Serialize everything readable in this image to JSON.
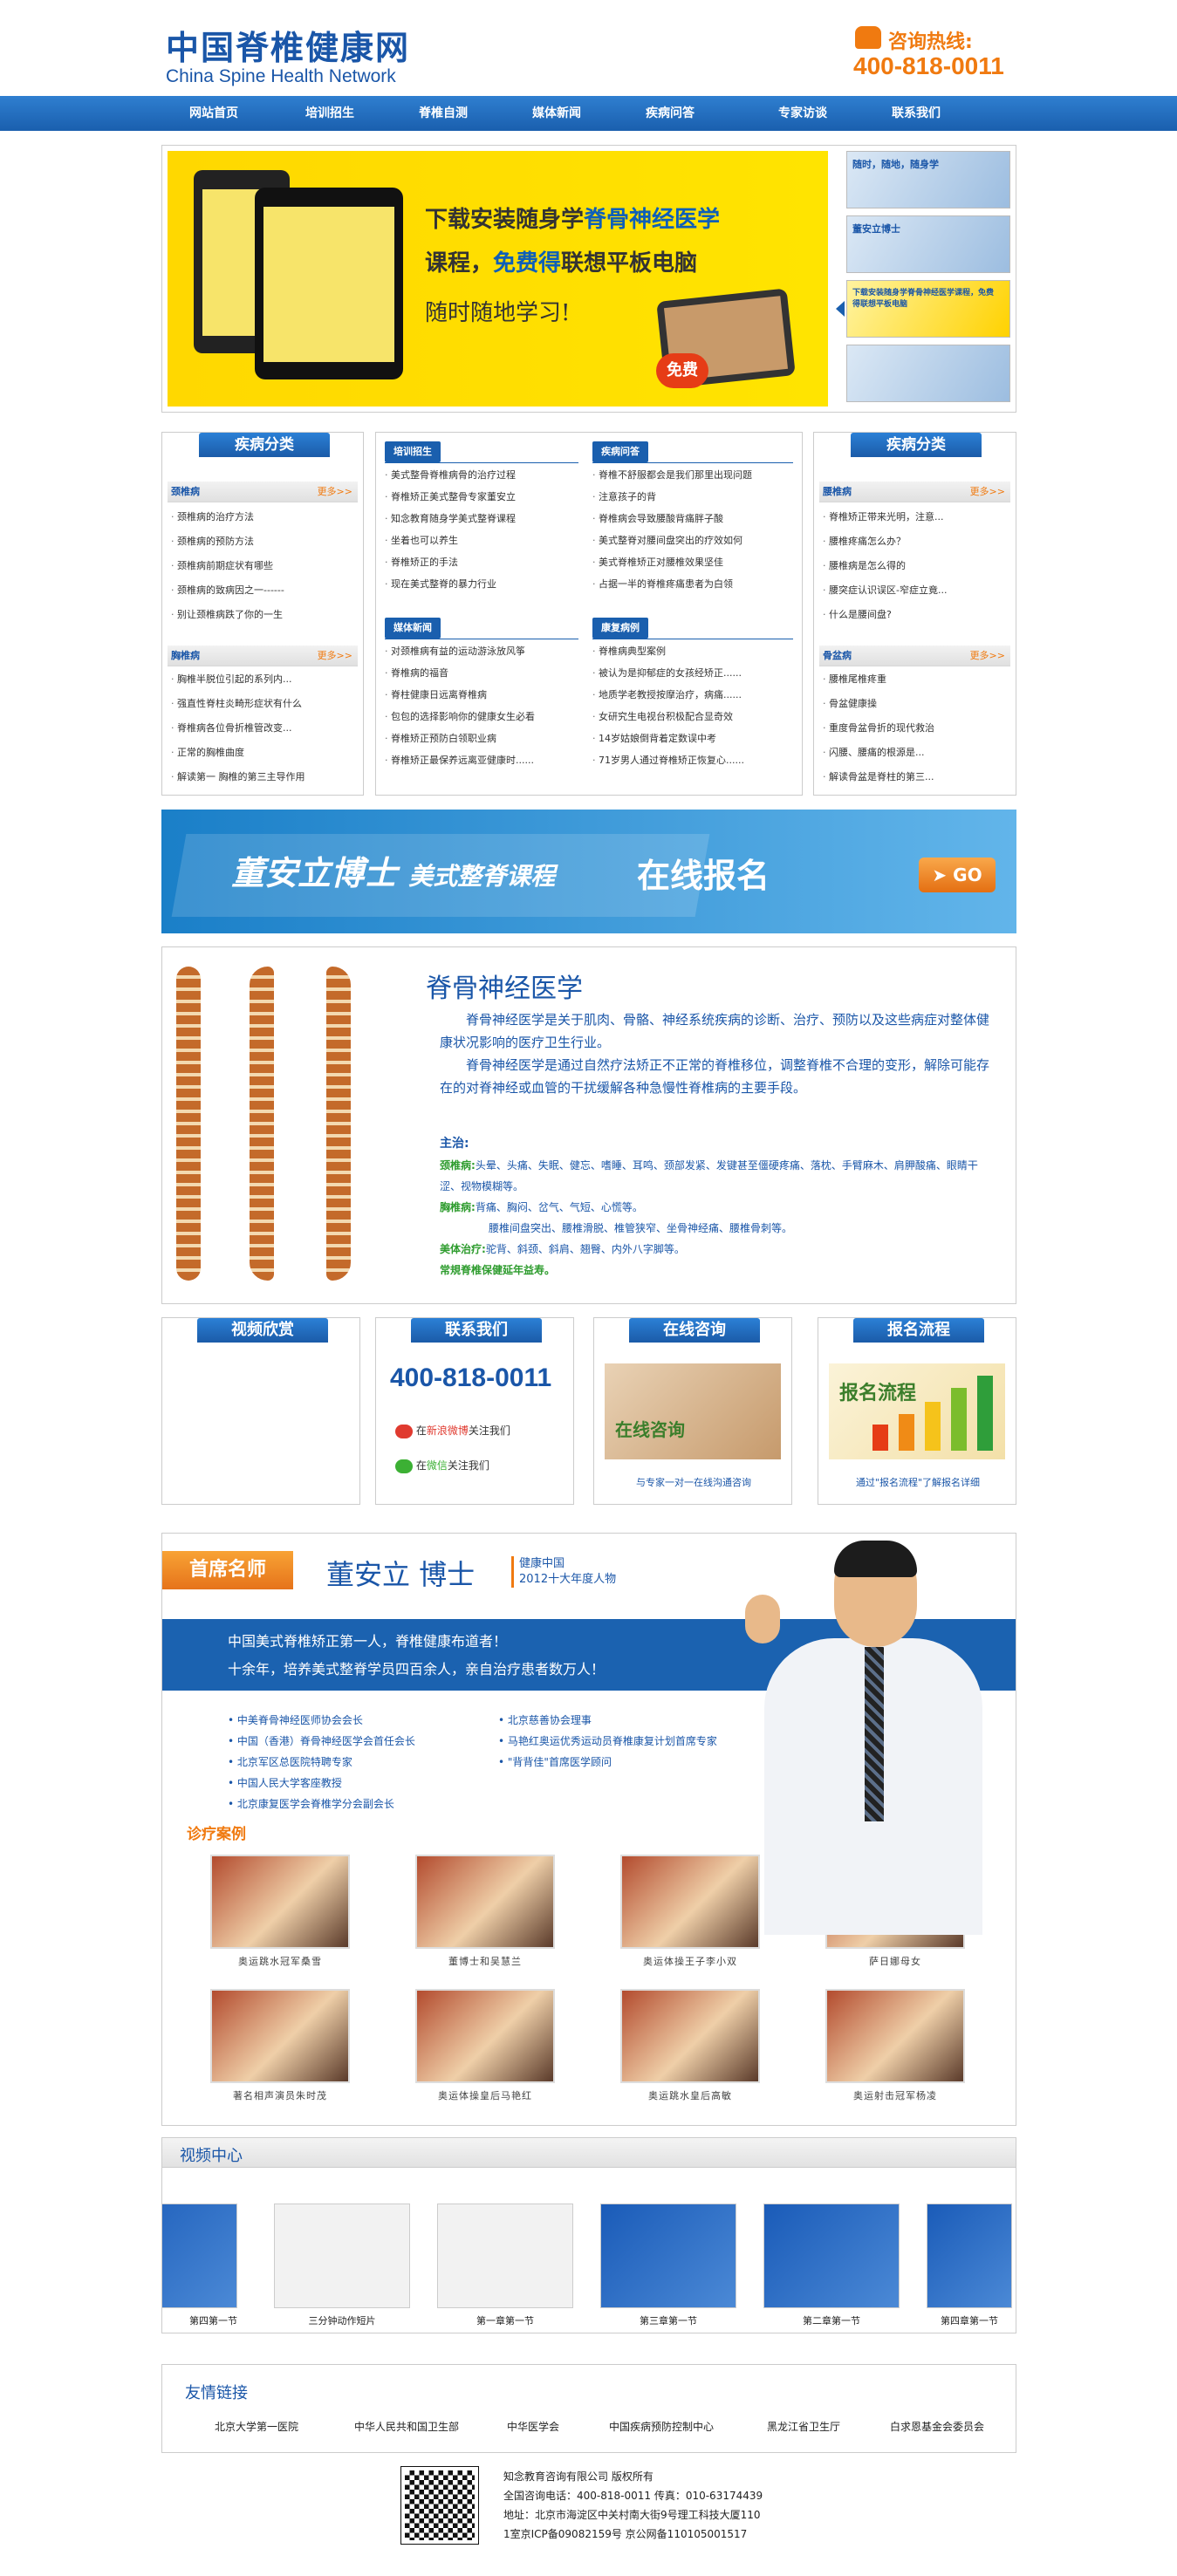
{
  "header": {
    "logo_title": "中国脊椎健康网",
    "logo_sub": "China Spine Health Network",
    "hotline_label": "咨询热线:",
    "hotline_number": "400-818-0011"
  },
  "nav": [
    "网站首页",
    "培训招生",
    "脊椎自测",
    "媒体新闻",
    "疾病问答",
    "专家访谈",
    "联系我们"
  ],
  "banner": {
    "line1_a": "下载安装随身学",
    "line1_b": "脊骨神经医学",
    "line2_a": "课程，",
    "line2_b": "免费得",
    "line2_c": "联想平板电脑",
    "line3": "随时随地学习!",
    "free": "免费",
    "thumbs": [
      "随时，随地，随身学",
      "董安立博士",
      "下载安装随身学脊骨神经医学课程，免费得联想平板电脑",
      ""
    ]
  },
  "left_cat": {
    "title": "疾病分类",
    "more": "更多>>",
    "g1_label": "颈椎病",
    "g1": [
      "颈椎病的治疗方法",
      "颈椎病的预防方法",
      "颈椎病前期症状有哪些",
      "颈椎病的致病因之一------",
      "别让颈椎病跌了你的一生"
    ],
    "g2_label": "胸椎病",
    "g2": [
      "胸椎半脱位引起的系列内...",
      "强直性脊柱炎畸形症状有什么",
      "脊椎病各位骨折椎管改变...",
      "正常的胸椎曲度",
      "解读第一 胸椎的第三主导作用"
    ]
  },
  "mid": {
    "h1": "培训招生",
    "l1": [
      "美式整骨脊椎病骨的治疗过程",
      "脊椎矫正美式整骨专家董安立",
      "知念教育随身学美式整脊课程",
      "坐着也可以养生",
      "脊椎矫正的手法",
      "现在美式整脊的暴力行业"
    ],
    "h2": "疾病问答",
    "l2": [
      "脊椎不舒服都会是我们那里出现问题",
      "注意孩子的背",
      "脊椎病会导致腰酸背痛胖子酸",
      "美式整脊对腰间盘突出的疗效如何",
      "美式脊椎矫正对腰椎效果坚佳",
      "占据一半的脊椎疼痛患者为白领"
    ],
    "h3": "媒体新闻",
    "l3": [
      "对颈椎病有益的运动游泳放风筝",
      "脊椎病的福音",
      "脊柱健康日远离脊椎病",
      "包包的选择影响你的健康女生必看",
      "脊椎矫正预防白领职业病",
      "脊椎矫正最保养远离亚健康时......"
    ],
    "h4": "康复病例",
    "l4": [
      "脊椎病典型案例",
      "被认为是抑郁症的女孩经矫正......",
      "地质学老教授按摩治疗，病痛......",
      "女研究生电视台积极配合显奇效",
      "14岁姑娘倒背着定数误中考",
      "71岁男人通过脊椎矫正恢复心......"
    ]
  },
  "right_cat": {
    "title": "疾病分类",
    "more": "更多>>",
    "g1_label": "腰椎病",
    "g1": [
      "脊椎矫正带来光明，注意...",
      "腰椎疼痛怎么办？",
      "腰椎病是怎么得的",
      "腰突症认识误区-窄症立竟...",
      "什么是腰间盘?"
    ],
    "g2_label": "骨盆病",
    "g2": [
      "腰椎尾椎疼重",
      "骨盆健康操",
      "重度骨盆骨折的现代救治",
      "闪腰、腰痛的根源是...",
      "解读骨盆是脊柱的第三..."
    ]
  },
  "dong_banner": {
    "title_a": "董安立博士",
    "title_b": "美式整脊课程",
    "online": "在线报名",
    "go": "GO"
  },
  "spine": {
    "title": "脊骨神经医学",
    "p1": "脊骨神经医学是关于肌肉、骨骼、神经系统疾病的诊断、治疗、预防以及这些病症对整体健康状况影响的医疗卫生行业。",
    "p2": "脊骨神经医学是通过自然疗法矫正不正常的脊椎移位，调整脊椎不合理的变形，解除可能存在的对脊神经或血管的干扰缓解各种急慢性脊椎病的主要手段。",
    "zhu": "主治:",
    "r1_k": "颈椎病:",
    "r1": "头晕、头痛、失眠、健忘、嗜睡、耳鸣、颈部发紧、发键甚至僵硬疼痛、落枕、手臂麻木、肩胛酸痛、眼睛干涩、视物模糊等。",
    "r2_k": "胸椎病:",
    "r2": "背痛、胸闷、岔气、气短、心慌等。",
    "r3_k": "腰椎病:",
    "r3": "腰椎间盘突出、腰椎滑脱、椎管狭窄、坐骨神经痛、腰椎骨刺等。",
    "r4_k": "美体治疗:",
    "r4": "驼背、斜颈、斜肩、翘臀、内外八字脚等。",
    "r5": "常規脊椎保健延年益寿。"
  },
  "small_boxes": {
    "video": "视频欣赏",
    "contact": "联系我们",
    "contact_phone": "400-818-0011",
    "weibo_a": "在",
    "weibo_b": "新浪微博",
    "weibo_c": "关注我们",
    "wechat_a": "在",
    "wechat_b": "微信",
    "wechat_c": "关注我们",
    "consult": "在线咨询",
    "consult_img": "在线咨询",
    "consult_cap": "与专家一对一在线沟通咨询",
    "flow": "报名流程",
    "flow_img": "报名流程",
    "flow_cap": "通过\"报名流程\"了解报名详细"
  },
  "doctor": {
    "tag": "首席名师",
    "name": "董安立  博士",
    "award1": "健康中国",
    "award2": "2012十大年度人物",
    "line1": "中国美式脊椎矫正第一人，脊椎健康布道者！",
    "line2": "十余年，培养美式整脊学员四百余人，亲自治疗患者数万人！",
    "titles_left": [
      "中美脊骨神经医师协会会长",
      "中国（香港）脊骨神经医学会首任会长",
      "北京军区总医院特聘专家",
      "中国人民大学客座教授",
      "北京康复医学会脊椎学分会副会长"
    ],
    "titles_right": [
      "北京慈善协会理事",
      "马艳红奥运优秀运动员脊椎康复计划首席专家",
      "\"背背佳\"首席医学顾问"
    ],
    "case_label": "诊疗案例",
    "cases": [
      "奥运跳水冠军桑雪",
      "董博士和吴慧兰",
      "奥运体操王子李小双",
      "萨日娜母女",
      "著名相声演员朱时茂",
      "奥运体操皇后马艳红",
      "奥运跳水皇后高敏",
      "奥运射击冠军杨凌"
    ]
  },
  "video_center": {
    "title": "视频中心",
    "items": [
      "第四第一节",
      "三分钟动作短片",
      "第一章第一节",
      "第三章第一节",
      "第二章第一节",
      "第四章第一节"
    ]
  },
  "links": {
    "title": "友情链接",
    "items": [
      "北京大学第一医院",
      "中华人民共和国卫生部",
      "中华医学会",
      "中国疾病预防控制中心",
      "黑龙江省卫生厅",
      "白求恩基金会委员会"
    ]
  },
  "footer": {
    "l1": "知念教育咨询有限公司 版权所有",
    "l2": "全国咨询电话：400-818-0011 传真：010-63174439",
    "l3": "地址：北京市海淀区中关村南大街9号理工科技大厦110",
    "l4": "1室京ICP备09082159号 京公网备110105001517"
  }
}
